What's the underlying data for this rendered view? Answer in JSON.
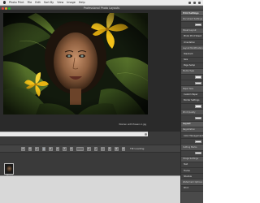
{
  "menubar": {
    "items": [
      "Photo Print",
      "File",
      "Edit",
      "Sort By",
      "View",
      "Image",
      "Help"
    ]
  },
  "window": {
    "title": "Professional Photo Layouts"
  },
  "image": {
    "info": "Women with flowers 1.jpg"
  },
  "toolbar": {
    "buttons": [
      "Z",
      "Q",
      "S",
      "",
      "R",
      "C",
      "T",
      "S",
      "",
      "P",
      "i",
      "↔",
      "↕",
      "⊕",
      "⊖"
    ],
    "label": "Tilt Loading"
  },
  "filmstrip": {
    "thumb_caption": "Woman"
  },
  "sidebar": {
    "rows": [
      {
        "text": "Print Settings",
        "kind": "hdr"
      },
      {
        "text": "Document Settings",
        "kind": "sub"
      },
      {
        "text": "",
        "kind": "field"
      },
      {
        "text": "Sheet Layout",
        "kind": "sub"
      },
      {
        "text": "Photo Print Sheet",
        "kind": "field"
      },
      {
        "text": "Orientation",
        "kind": "field"
      },
      {
        "text": "Layout Modification",
        "kind": "sub"
      },
      {
        "text": "Standard",
        "kind": "field"
      },
      {
        "text": "Size",
        "kind": "field"
      },
      {
        "text": "Page Setup",
        "kind": "field"
      },
      {
        "text": "Media Type",
        "kind": "sub"
      },
      {
        "text": "",
        "kind": "field"
      },
      {
        "text": "",
        "kind": "field"
      },
      {
        "text": "Paper Size",
        "kind": "sub"
      },
      {
        "text": "Custom Paper",
        "kind": "field"
      },
      {
        "text": "Border Settings",
        "kind": "field"
      },
      {
        "text": "",
        "kind": "field"
      },
      {
        "text": "Print Quality",
        "kind": "sub"
      },
      {
        "text": "",
        "kind": "field"
      },
      {
        "text": "Layout",
        "kind": "hdr"
      },
      {
        "text": "Registration",
        "kind": "sub"
      },
      {
        "text": "Color Management",
        "kind": "field"
      },
      {
        "text": "",
        "kind": "field"
      },
      {
        "text": "Cutting Marks",
        "kind": "sub"
      },
      {
        "text": "",
        "kind": "field"
      },
      {
        "text": "Image Settings",
        "kind": "sub"
      },
      {
        "text": "Text",
        "kind": "field"
      },
      {
        "text": "Frame",
        "kind": "field"
      },
      {
        "text": "Shadow",
        "kind": "field"
      },
      {
        "text": "Watermark Options",
        "kind": "sub"
      },
      {
        "text": "Print",
        "kind": "field"
      }
    ]
  },
  "colors": {
    "window_bg": "#3a3a3a",
    "panel_bg": "#4a4a4a",
    "accent_yellow": "#f2c21a"
  }
}
